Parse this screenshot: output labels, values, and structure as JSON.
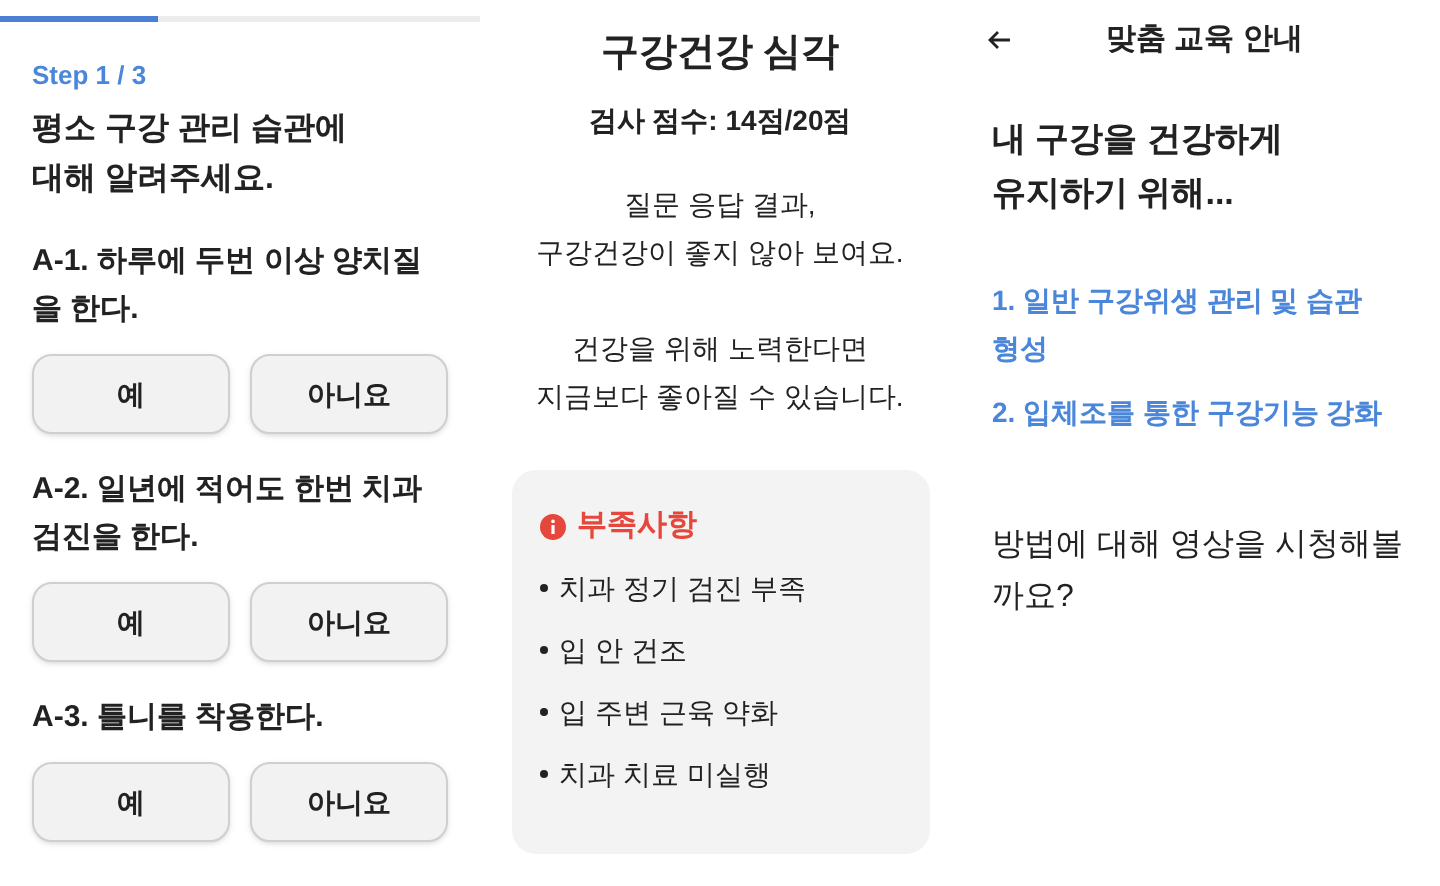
{
  "survey": {
    "progress": {
      "level": 0.33
    },
    "step": "Step 1 / 3",
    "title": "평소 구강 관리 습관에\n대해 알려주세요.",
    "questions": [
      {
        "text": "A-1. 하루에 두번 이상 양치질\n을 한다.",
        "options": [
          "예",
          "아니요"
        ]
      },
      {
        "text": "A-2. 일년에 적어도 한번 치과\n검진을 한다.",
        "options": [
          "예",
          "아니요"
        ]
      },
      {
        "text": "A-3. 틀니를 착용한다.",
        "options": [
          "예",
          "아니요"
        ]
      }
    ]
  },
  "result": {
    "title": "구강건강 심각",
    "score": "검사 점수: 14점/20점",
    "message_1": "질문 응답 결과,\n구강건강이 좋지 않아 보여요.",
    "message_2": "건강을 위해 노력한다면\n지금보다 좋아질 수 있습니다.",
    "deficiencies": {
      "title": "부족사항",
      "items": [
        "치과 정기 검진 부족",
        "입 안 건조",
        "입 주변 근육 약화",
        "치과 치료 미실행"
      ]
    }
  },
  "education": {
    "title": "맞춤 교육 안내",
    "heading": "내 구강을 건강하게\n유지하기 위해...",
    "links": [
      "1. 일반 구강위생 관리 및 습관\n형성",
      "2. 입체조를 통한 구강기능 강화"
    ],
    "question": "방법에 대해 영상을 시청해볼\n까요?"
  }
}
